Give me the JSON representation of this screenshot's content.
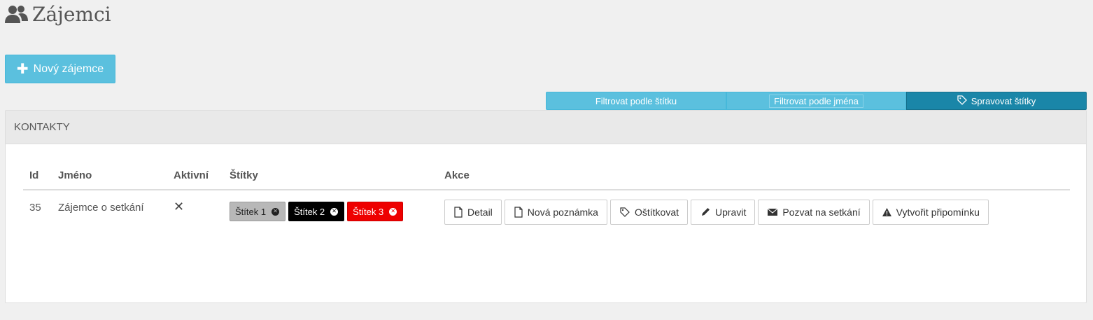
{
  "page": {
    "title": "Zájemci",
    "title_icon": "users-icon"
  },
  "toolbar": {
    "new_label": "Nový zájemce",
    "new_icon": "plus-icon"
  },
  "filters": {
    "by_tag": "Filtrovat podle štítku",
    "by_name": "Filtrovat podle jména",
    "manage_tags": "Spravovat štítky",
    "manage_icon": "tag-icon"
  },
  "panel": {
    "heading": "KONTAKTY"
  },
  "table": {
    "headers": {
      "id": "Id",
      "name": "Jméno",
      "active": "Aktivní",
      "tags": "Štítky",
      "actions": "Akce"
    },
    "rows": [
      {
        "id": "35",
        "name": "Zájemce o setkání",
        "active": "✕",
        "tags": [
          {
            "label": "Štítek 1",
            "color": "#b8b8b8"
          },
          {
            "label": "Štítek 2",
            "color": "#000000"
          },
          {
            "label": "Štítek 3",
            "color": "#ee0000"
          }
        ],
        "actions": {
          "detail": "Detail",
          "new_note": "Nová poznámka",
          "tag": "Oštítkovat",
          "edit": "Upravit",
          "invite": "Pozvat na setkání",
          "reminder": "Vytvořit připomínku"
        }
      }
    ]
  },
  "colors": {
    "accent": "#5bc0de",
    "accent_dark": "#1a86a8"
  }
}
